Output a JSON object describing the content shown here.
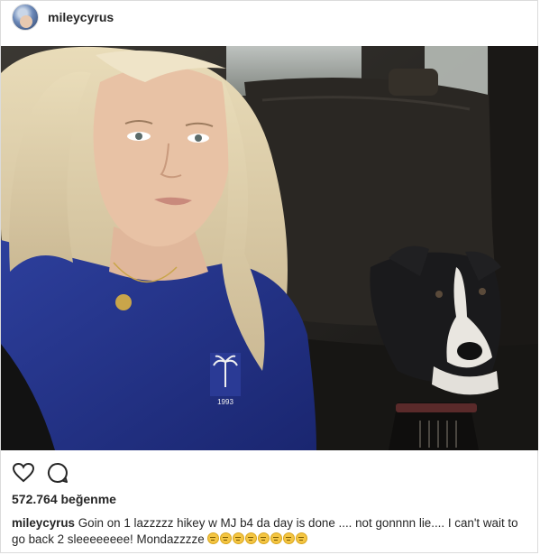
{
  "header": {
    "username": "mileycyrus",
    "avatar_icon": "profile-avatar"
  },
  "photo": {
    "shirt_print_text": "1993"
  },
  "actions": {
    "like_icon": "heart-outline-icon",
    "comment_icon": "comment-bubble-icon"
  },
  "likes": {
    "text": "572.764 beğenme"
  },
  "caption": {
    "username": "mileycyrus",
    "text": "Goin on 1 lazzzzz hikey w MJ b4 da day is done .... not gonnnn lie.... I can't wait to go back 2 sleeeeeeee! Mondazzzze",
    "emoji_name": "sleepy-face-emoji",
    "emoji_count": 8
  }
}
